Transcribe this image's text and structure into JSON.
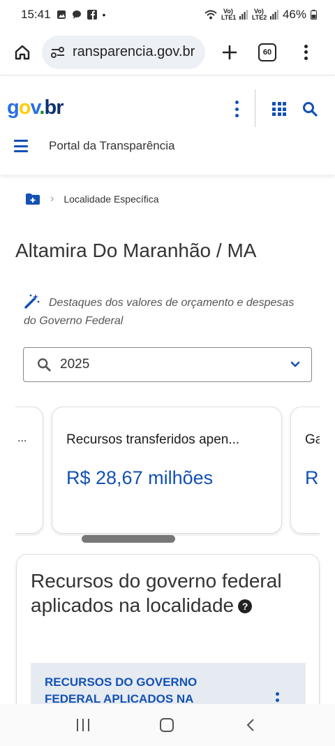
{
  "status_bar": {
    "time": "15:41",
    "sim1": "Vo) LTE1",
    "sim2": "Vo) LTE2",
    "battery": "46%"
  },
  "browser": {
    "url": "ransparencia.gov.br",
    "tab_count": "60"
  },
  "gov_header": {
    "logo_parts": [
      "g",
      "o",
      "v",
      ".",
      "br"
    ],
    "portal_title": "Portal da Transparência"
  },
  "breadcrumb": {
    "current": "Localidade Específica"
  },
  "page": {
    "title": "Altamira Do Maranhão / MA",
    "highlights_text": "Destaques dos valores de orçamento e despesas do Governo Federal",
    "year_select": "2025"
  },
  "cards": [
    {
      "label": "...",
      "value": ""
    },
    {
      "label": "Recursos transferidos apen...",
      "value": "R$ 28,67 milhões"
    },
    {
      "label": "Ga",
      "value": "R"
    }
  ],
  "section": {
    "title": "Recursos do governo federal aplicados na localidade",
    "help_icon": "?",
    "sub_heading": "RECURSOS DO GOVERNO FEDERAL APLICADOS NA"
  },
  "colors": {
    "accent": "#1351b4",
    "logo_blue": "#2670e8",
    "logo_yellow": "#ffcd07",
    "logo_green": "#168821",
    "logo_navy": "#0c326f"
  }
}
